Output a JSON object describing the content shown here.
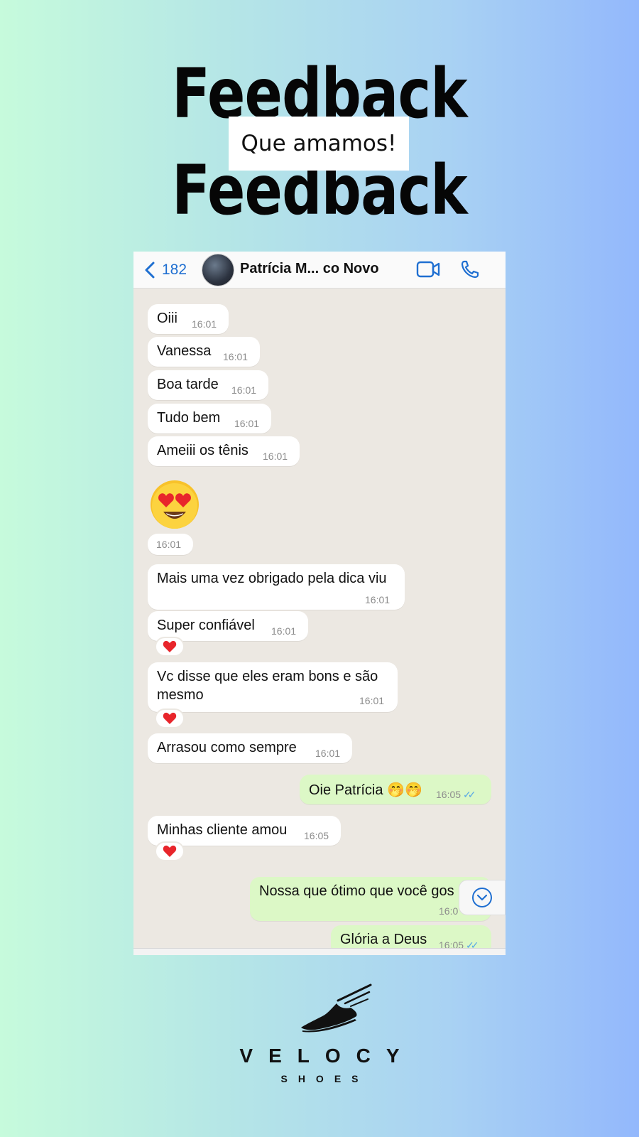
{
  "header": {
    "title": "Feedback",
    "subtitle": "Que amamos!"
  },
  "chat": {
    "back_count": "182",
    "contact_name": "Patrícia M... co Novo",
    "messages": [
      {
        "text": "Oiii",
        "time": "16:01"
      },
      {
        "text": "Vanessa",
        "time": "16:01"
      },
      {
        "text": "Boa tarde",
        "time": "16:01"
      },
      {
        "text": "Tudo bem",
        "time": "16:01"
      },
      {
        "text": "Ameiii os tênis",
        "time": "16:01"
      },
      {
        "emoji": "heart-eyes-emoji",
        "time": "16:01"
      },
      {
        "text": "Mais uma vez obrigado pela dica viu",
        "time": "16:01"
      },
      {
        "text": "Super confiável",
        "time": "16:01",
        "reaction": "❤"
      },
      {
        "text_line1": "Vc disse que eles eram bons e são",
        "text_line2": "mesmo",
        "time": "16:01",
        "reaction": "❤"
      },
      {
        "text": "Arrasou como sempre",
        "time": "16:01"
      },
      {
        "text": "Oie Patrícia 🤭🤭",
        "time": "16:05",
        "outgoing": true
      },
      {
        "text": "Minhas cliente amou",
        "time": "16:05",
        "reaction": "❤"
      },
      {
        "text": "Nossa que ótimo que você gos",
        "time": "16:0",
        "outgoing": true
      },
      {
        "text": "Glória a Deus",
        "time": "16:05",
        "outgoing": true
      }
    ]
  },
  "brand": {
    "name": "VELOCY",
    "sub": "SHOES"
  },
  "colors": {
    "incoming_bubble": "#ffffff",
    "outgoing_bubble": "#dcf8c6",
    "link_blue": "#1f6fd1",
    "chat_bg": "#ece8e2"
  }
}
